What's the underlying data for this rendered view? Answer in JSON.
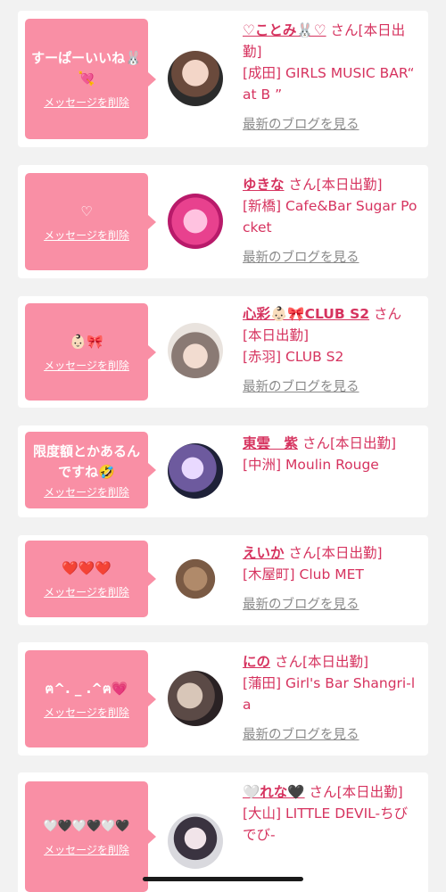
{
  "list": {
    "delete_label": "メッセージを削除",
    "blog_label": "最新のブログを見る",
    "san": "さん",
    "items": [
      {
        "message": "すーぱーいいね🐰💘",
        "name": "♡ことみ🐰♡",
        "status": "[本日出勤]",
        "area": "[成田]",
        "shop": "GIRLS MUSIC BAR“ at B ”"
      },
      {
        "message": "♡",
        "name": "ゆきな",
        "status": "[本日出勤]",
        "area": "[新橋]",
        "shop": "Cafe&Bar Sugar Pocket"
      },
      {
        "message": "👶🏻🎀",
        "name": "心彩👶🏻🎀CLUB S2",
        "status": "[本日出勤]",
        "area": "[赤羽]",
        "shop": "CLUB S2"
      },
      {
        "message": "限度額とかあるんですね🤣",
        "name": "東雲　紫",
        "status": "[本日出勤]",
        "area": "[中洲]",
        "shop": "Moulin Rouge"
      },
      {
        "message": "❤️❤️❤️",
        "name": "えいか",
        "status": "[本日出勤]",
        "area": "[木屋町]",
        "shop": "Club MET"
      },
      {
        "message": "ฅ^. _ .^ฅ💗",
        "name": "にの",
        "status": "[本日出勤]",
        "area": "[蒲田]",
        "shop": "Girl's Bar Shangri-la"
      },
      {
        "message": "🤍🖤🤍🖤🤍🖤",
        "name": "🤍れな🖤",
        "status": "[本日出勤]",
        "area": "[大山]",
        "shop": "LITTLE DEVIL-ちびでび-"
      }
    ]
  },
  "colors": {
    "accent": "#d6335f",
    "bubble": "#f98fa5",
    "background": "#f2f2f2"
  }
}
